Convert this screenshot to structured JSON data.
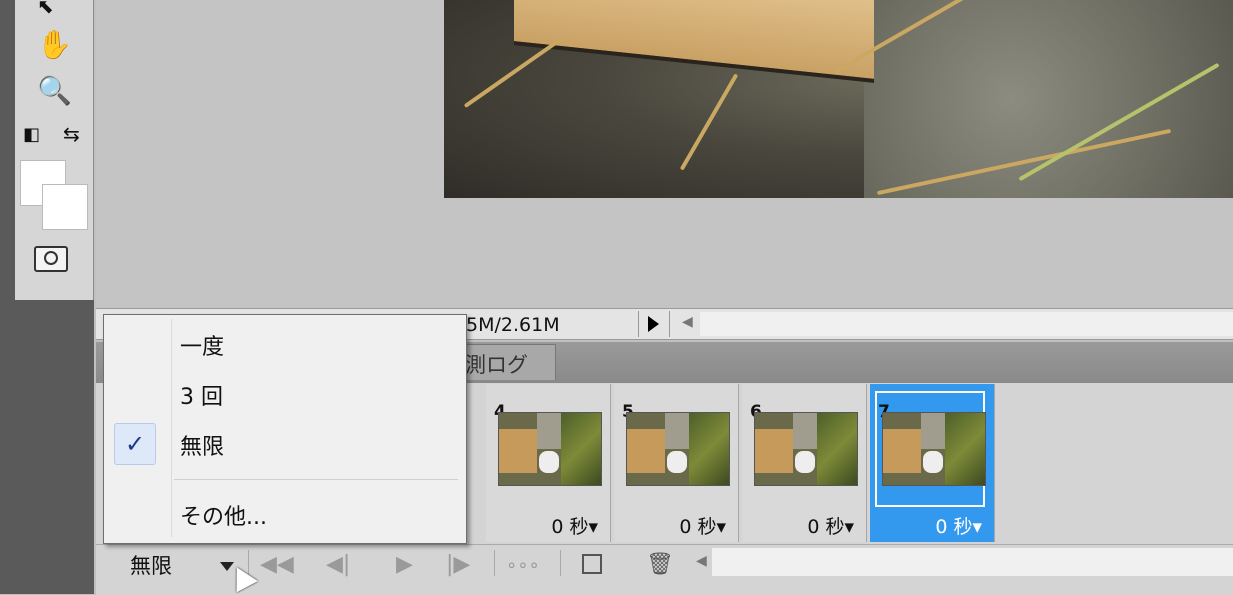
{
  "status": {
    "doc_size": "5M/2.61M"
  },
  "panel": {
    "tab_label": "測ログ"
  },
  "frames": [
    {
      "number": "4",
      "delay": "0 秒▾"
    },
    {
      "number": "5",
      "delay": "0 秒▾"
    },
    {
      "number": "6",
      "delay": "0 秒▾"
    },
    {
      "number": "7",
      "delay": "0 秒▾"
    }
  ],
  "loop": {
    "selected": "無限"
  },
  "menu": {
    "items": [
      "一度",
      "3 回",
      "無限",
      "その他..."
    ],
    "checked": "✓"
  },
  "icons": {
    "hand": "hand-icon",
    "zoom": "zoom-icon",
    "default_colors": "default-colors-icon",
    "swap_colors": "swap-colors-icon",
    "quick_mask": "quick-mask-icon",
    "first_frame": "first-frame-icon",
    "prev_frame": "previous-frame-icon",
    "play": "play-icon",
    "next_frame": "next-frame-icon",
    "tween": "tween-icon",
    "new_frame": "new-frame-icon",
    "delete": "trash-icon"
  },
  "colors": {
    "selection": "#3399ee",
    "panel_bg": "#d4d4d4"
  }
}
